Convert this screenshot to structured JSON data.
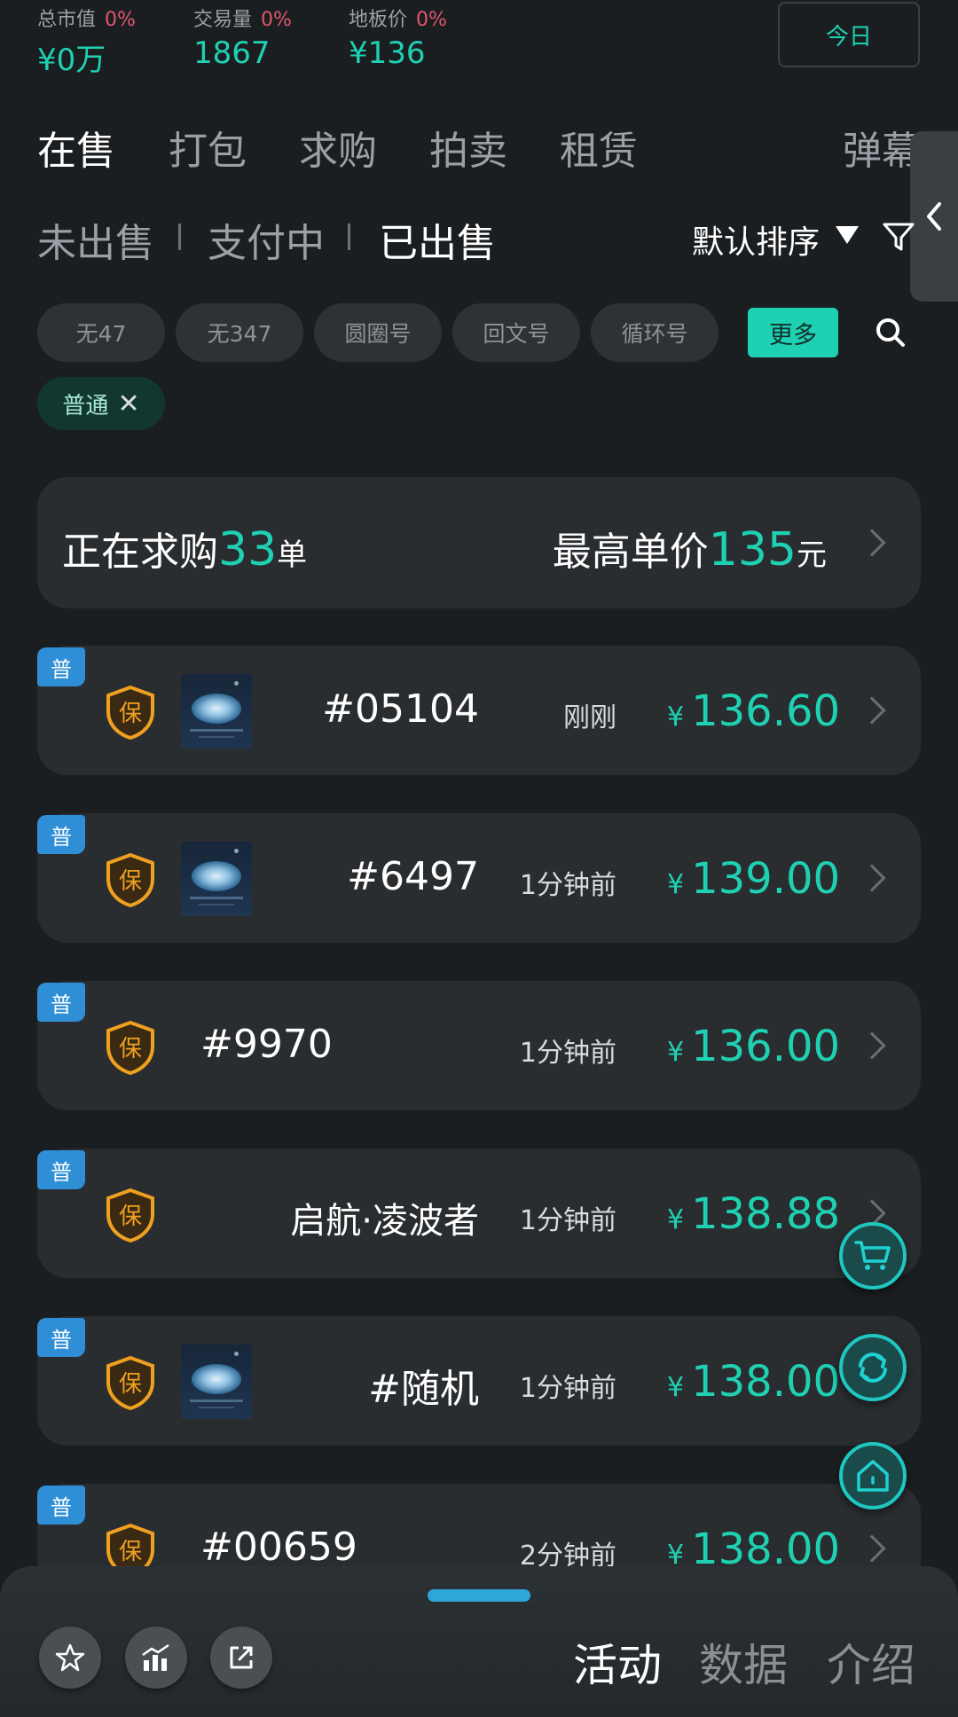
{
  "stats": [
    {
      "label": "总市值",
      "pct": "0%",
      "value": "¥0万"
    },
    {
      "label": "交易量",
      "pct": "0%",
      "value": "1867"
    },
    {
      "label": "地板价",
      "pct": "0%",
      "value": "¥136"
    }
  ],
  "today_label": "今日",
  "main_tabs": [
    "在售",
    "打包",
    "求购",
    "拍卖",
    "租赁",
    "弹幕"
  ],
  "sub_tabs": [
    "未出售",
    "支付中",
    "已出售"
  ],
  "sort_label": "默认排序",
  "chips": [
    "无47",
    "无347",
    "圆圈号",
    "回文号",
    "循环号"
  ],
  "more_label": "更多",
  "active_tag": "普通",
  "buy_banner": {
    "prefix": "正在求购",
    "count": "33",
    "count_unit": "单",
    "price_prefix": "最高单价",
    "price": "135",
    "price_unit": "元"
  },
  "badge_label": "普",
  "shield_label": "保",
  "currency": "¥",
  "listings": [
    {
      "name": "#05104",
      "time": "刚刚",
      "price": "136.60"
    },
    {
      "name": "#6497",
      "time": "1分钟前",
      "price": "139.00"
    },
    {
      "name": "#9970",
      "time": "1分钟前",
      "price": "136.00"
    },
    {
      "name": "启航·凌波者",
      "time": "1分钟前",
      "price": "138.88"
    },
    {
      "name": "#随机",
      "time": "1分钟前",
      "price": "138.00"
    },
    {
      "name": "#00659",
      "time": "2分钟前",
      "price": "138.00"
    }
  ],
  "bottom_tabs": [
    "活动",
    "数据",
    "介绍"
  ],
  "colors": {
    "accent": "#1fd1b3",
    "negative": "#e0566e",
    "badge": "#2f8fd6"
  }
}
